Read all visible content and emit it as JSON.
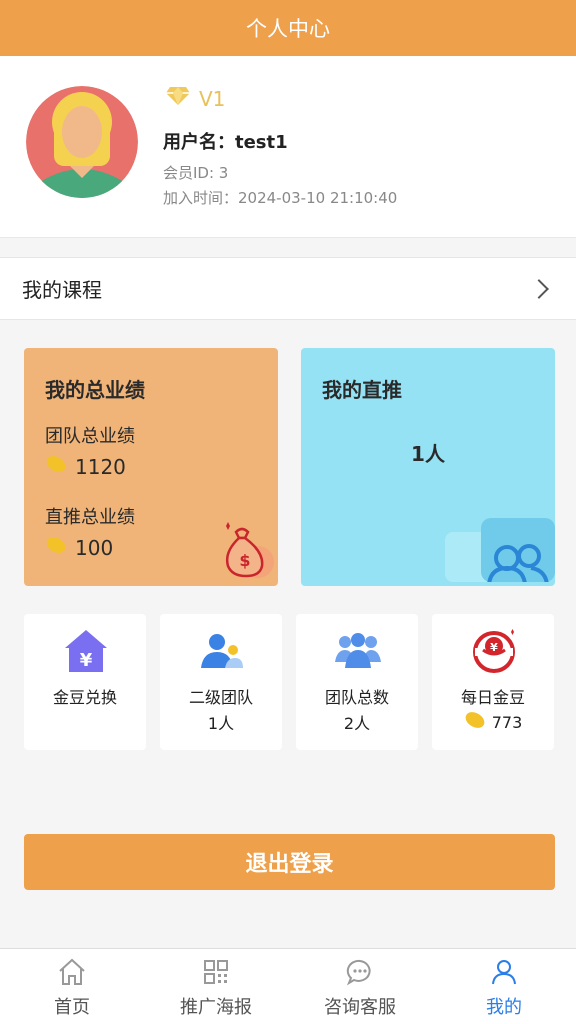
{
  "header": {
    "title": "个人中心"
  },
  "profile": {
    "level": "V1",
    "username": "用户名：test1",
    "member_id": "会员ID: 3",
    "join_time": "加入时间：2024-03-10 21:10:40"
  },
  "course": {
    "label": "我的课程"
  },
  "performance": {
    "title": "我的总业绩",
    "team_label": "团队总业绩",
    "team_value": "1120",
    "direct_label": "直推总业绩",
    "direct_value": "100"
  },
  "direct": {
    "title": "我的直推",
    "count": "1人"
  },
  "grid": [
    {
      "label": "金豆兑换",
      "value": ""
    },
    {
      "label": "二级团队",
      "value": "1人"
    },
    {
      "label": "团队总数",
      "value": "2人"
    },
    {
      "label": "每日金豆",
      "value": "773"
    }
  ],
  "logout": {
    "label": "退出登录"
  },
  "tabs": [
    {
      "label": "首页",
      "icon": "home-icon"
    },
    {
      "label": "推广海报",
      "icon": "qrcode-icon"
    },
    {
      "label": "咨询客服",
      "icon": "chat-icon"
    },
    {
      "label": "我的",
      "icon": "user-icon"
    }
  ],
  "colors": {
    "accent": "#eea04a",
    "active_tab": "#2b7ee8",
    "card_orange": "#f0b478",
    "card_blue": "#94e2f3",
    "vip_gold": "#e7c15a"
  }
}
